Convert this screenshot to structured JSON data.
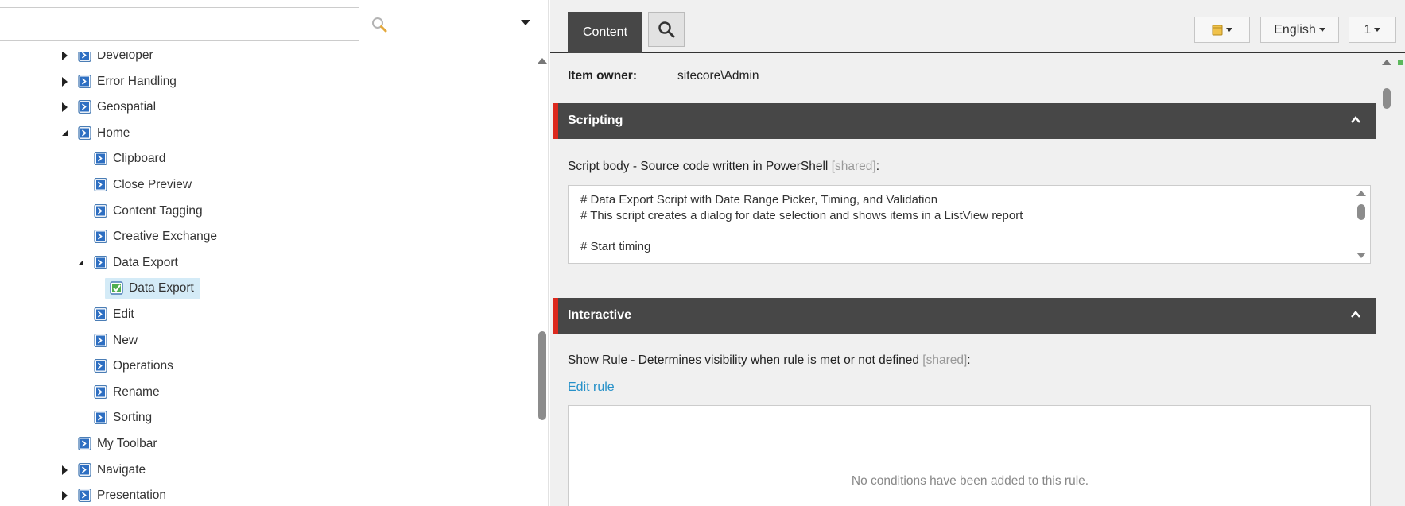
{
  "tree": {
    "search_placeholder": "",
    "nodes": [
      {
        "label": "Developer",
        "state": "closed",
        "level": 0
      },
      {
        "label": "Error Handling",
        "state": "closed",
        "level": 0
      },
      {
        "label": "Geospatial",
        "state": "closed",
        "level": 0
      },
      {
        "label": "Home",
        "state": "open",
        "level": 0
      },
      {
        "label": "Clipboard",
        "state": "leaf",
        "level": 1
      },
      {
        "label": "Close Preview",
        "state": "leaf",
        "level": 1
      },
      {
        "label": "Content Tagging",
        "state": "leaf",
        "level": 1
      },
      {
        "label": "Creative Exchange",
        "state": "leaf",
        "level": 1
      },
      {
        "label": "Data Export",
        "state": "open",
        "level": 1
      },
      {
        "label": "Data Export",
        "state": "selected",
        "level": 2
      },
      {
        "label": "Edit",
        "state": "leaf",
        "level": 1
      },
      {
        "label": "New",
        "state": "leaf",
        "level": 1
      },
      {
        "label": "Operations",
        "state": "leaf",
        "level": 1
      },
      {
        "label": "Rename",
        "state": "leaf",
        "level": 1
      },
      {
        "label": "Sorting",
        "state": "leaf",
        "level": 1
      },
      {
        "label": "My Toolbar",
        "state": "leaf",
        "level": 0
      },
      {
        "label": "Navigate",
        "state": "closed",
        "level": 0
      },
      {
        "label": "Presentation",
        "state": "closed",
        "level": 0
      }
    ]
  },
  "topbar": {
    "tab_content": "Content",
    "language": "English",
    "version": "1"
  },
  "item_owner": {
    "label": "Item owner:",
    "value": "sitecore\\Admin"
  },
  "scripting": {
    "title": "Scripting",
    "field_label": "Script body - Source code written in PowerShell",
    "shared": "[shared]",
    "colon": ":",
    "lines": [
      "# Data Export Script with Date Range Picker, Timing, and Validation",
      "# This script creates a dialog for date selection and shows items in a ListView report",
      "",
      "# Start timing"
    ]
  },
  "interactive": {
    "title": "Interactive",
    "field_label": "Show Rule - Determines visibility when rule is met or not defined",
    "shared": "[shared]",
    "colon": ":",
    "edit_rule": "Edit rule",
    "empty_text": "No conditions have been added to this rule."
  },
  "colors": {
    "section_bar": "#474747",
    "section_accent": "#dc291e",
    "link": "#2691c9",
    "selected_bg": "#d4ebf7"
  }
}
